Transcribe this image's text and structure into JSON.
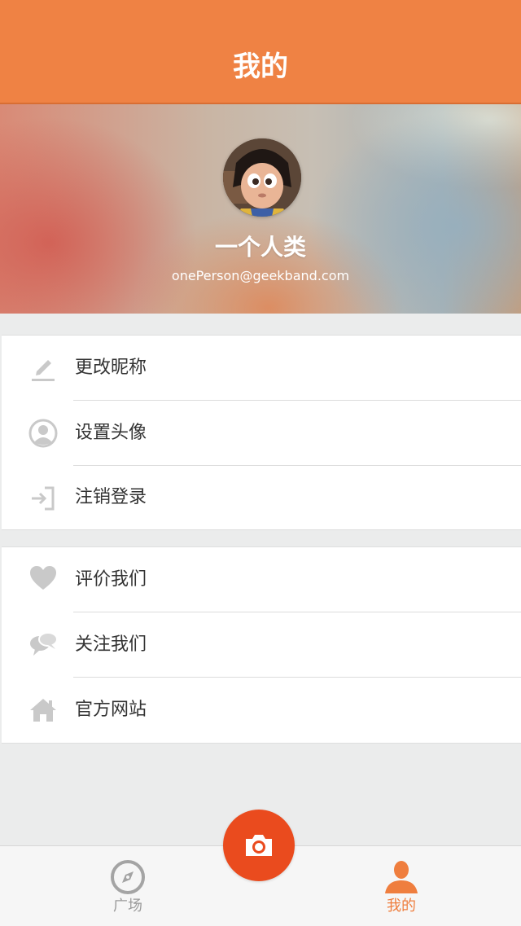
{
  "navbar": {
    "title": "我的"
  },
  "profile": {
    "name": "一个人类",
    "email": "onePerson@geekband.com"
  },
  "menu_group_1": [
    {
      "label": "更改昵称",
      "icon": "pencil-icon"
    },
    {
      "label": "设置头像",
      "icon": "user-circle-icon"
    },
    {
      "label": "注销登录",
      "icon": "logout-icon"
    }
  ],
  "menu_group_2": [
    {
      "label": "评价我们",
      "icon": "heart-icon"
    },
    {
      "label": "关注我们",
      "icon": "chat-bubbles-icon"
    },
    {
      "label": "官方网站",
      "icon": "home-icon"
    }
  ],
  "tabbar": {
    "square_label": "广场",
    "mine_label": "我的",
    "camera_icon": "camera-icon"
  },
  "colors": {
    "accent": "#ef8244",
    "camera_button": "#ea4b1e",
    "active_tab": "#ef7e3e",
    "inactive_tab": "#9b9b9b"
  }
}
